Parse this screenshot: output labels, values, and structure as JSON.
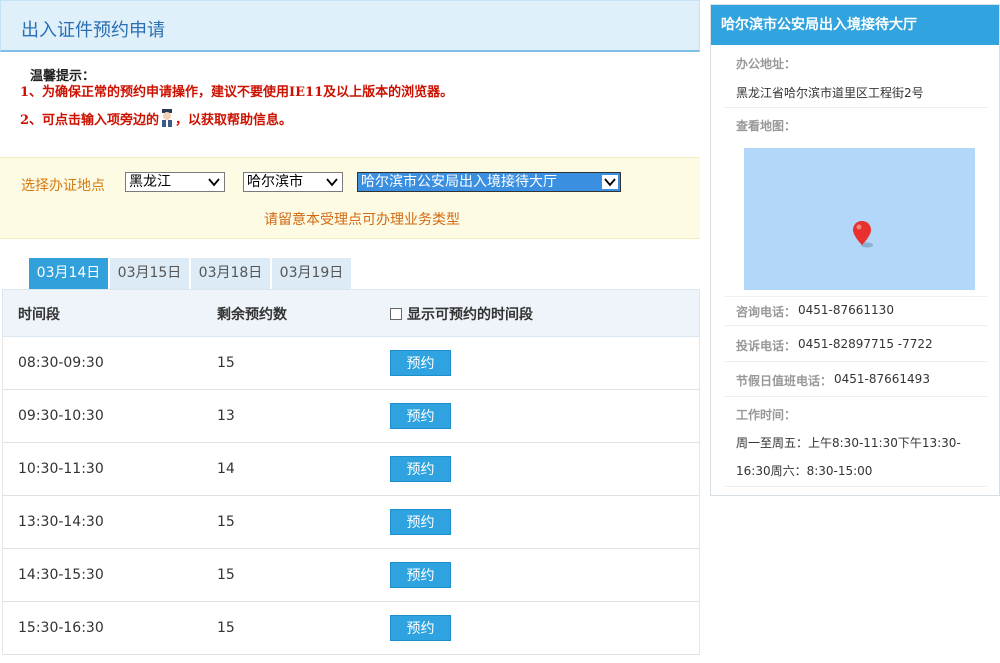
{
  "header": {
    "title": "出入证件预约申请"
  },
  "tips": {
    "title": "温馨提示：",
    "line1": "1、为确保正常的预约申请操作，建议不要使用IE11及以上版本的浏览器。",
    "line2_prefix": "2、可点击输入项旁边的",
    "line2_suffix": "，以获取帮助信息。"
  },
  "location": {
    "label": "选择办证地点",
    "province": "黑龙江",
    "city": "哈尔滨市",
    "office": "哈尔滨市公安局出入境接待大厅",
    "hint": "请留意本受理点可办理业务类型"
  },
  "tabs": [
    "03月14日",
    "03月15日",
    "03月18日",
    "03月19日"
  ],
  "table": {
    "col_time": "时间段",
    "col_remaining": "剩余预约数",
    "col_show_available": "显示可预约的时间段",
    "book_label": "预约",
    "rows": [
      {
        "time": "08:30-09:30",
        "remaining": "15"
      },
      {
        "time": "09:30-10:30",
        "remaining": "13"
      },
      {
        "time": "10:30-11:30",
        "remaining": "14"
      },
      {
        "time": "13:30-14:30",
        "remaining": "15"
      },
      {
        "time": "14:30-15:30",
        "remaining": "15"
      },
      {
        "time": "15:30-16:30",
        "remaining": "15"
      }
    ]
  },
  "sidebar": {
    "title": "哈尔滨市公安局出入境接待大厅",
    "address_label": "办公地址：",
    "address": "黑龙江省哈尔滨市道里区工程街2号",
    "map_label": "查看地图：",
    "consult_label": "咨询电话：",
    "consult_phone": "0451-87661130",
    "complaint_label": "投诉电话：",
    "complaint_phone": "0451-82897715 -7722",
    "holiday_label": "节假日值班电话：",
    "holiday_phone": "0451-87661493",
    "hours_label": "工作时间：",
    "hours_line1": "周一至周五：上午8:30-11:30下午13:30-",
    "hours_line2": "16:30周六：8:30-15:00"
  },
  "colors": {
    "accent": "#31a3de",
    "warning_text": "#cc1100",
    "location_label": "#d67a12",
    "map_bg": "#b3d7f8",
    "pin": "#e8312f"
  }
}
